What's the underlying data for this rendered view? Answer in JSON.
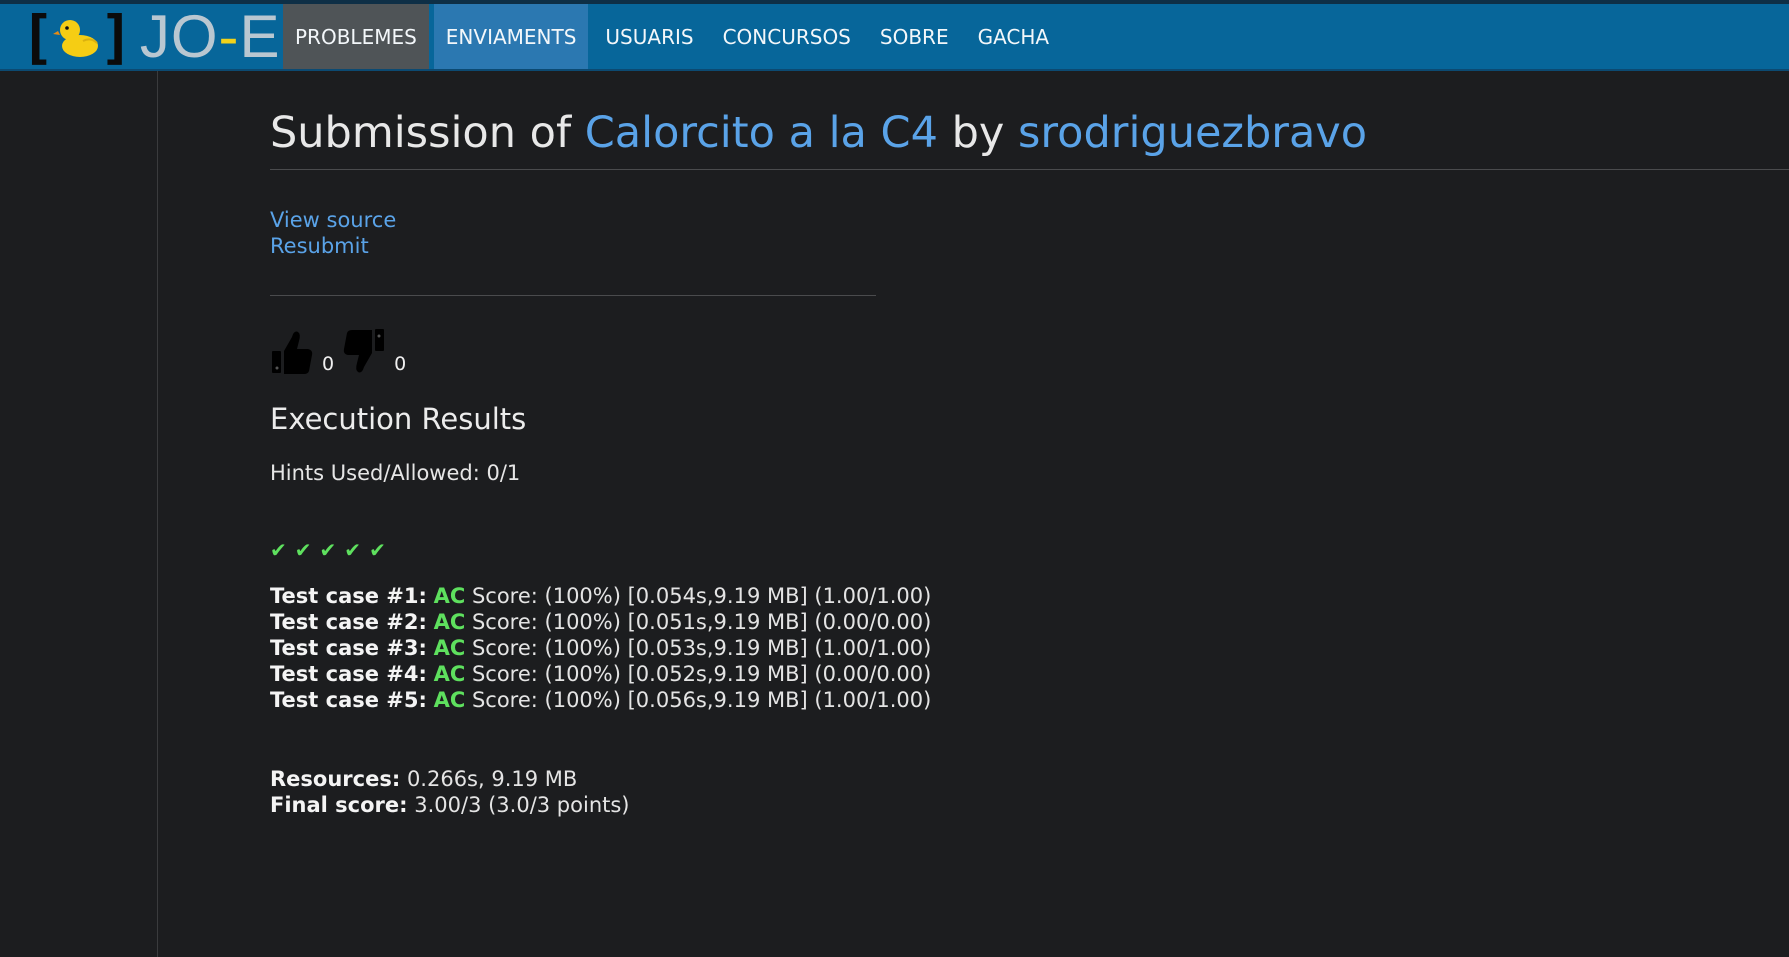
{
  "brand": {
    "left_bracket": "[",
    "right_bracket": "]",
    "name_part1": "JO",
    "dash": "-",
    "name_part2": "EL"
  },
  "nav": {
    "items": [
      {
        "label": "PROBLEMES"
      },
      {
        "label": "ENVIAMENTS"
      },
      {
        "label": "USUARIS"
      },
      {
        "label": "CONCURSOS"
      },
      {
        "label": "SOBRE"
      },
      {
        "label": "GACHA"
      }
    ]
  },
  "title": {
    "prefix": "Submission of",
    "problem": "Calorcito a la C4",
    "by": "by",
    "user": "srodriguezbravo"
  },
  "actions": {
    "view_source": "View source",
    "resubmit": "Resubmit"
  },
  "votes": {
    "up": "0",
    "down": "0"
  },
  "results": {
    "heading": "Execution Results",
    "hints": "Hints Used/Allowed: 0/1",
    "check_glyph": "✔",
    "tests": [
      {
        "label": "Test case #1:",
        "verdict": "AC",
        "detail": "Score: (100%) [0.054s,9.19 MB] (1.00/1.00)"
      },
      {
        "label": "Test case #2:",
        "verdict": "AC",
        "detail": "Score: (100%) [0.051s,9.19 MB] (0.00/0.00)"
      },
      {
        "label": "Test case #3:",
        "verdict": "AC",
        "detail": "Score: (100%) [0.053s,9.19 MB] (1.00/1.00)"
      },
      {
        "label": "Test case #4:",
        "verdict": "AC",
        "detail": "Score: (100%) [0.052s,9.19 MB] (0.00/0.00)"
      },
      {
        "label": "Test case #5:",
        "verdict": "AC",
        "detail": "Score: (100%) [0.056s,9.19 MB] (1.00/1.00)"
      }
    ],
    "resources_label": "Resources:",
    "resources_value": "0.266s, 9.19 MB",
    "final_label": "Final score:",
    "final_value": "3.00/3 (3.0/3 points)"
  },
  "colors": {
    "navbar": "#07669a",
    "accent_link": "#5aa3e8",
    "ac_green": "#5ee05e",
    "background": "#1c1d1f"
  }
}
